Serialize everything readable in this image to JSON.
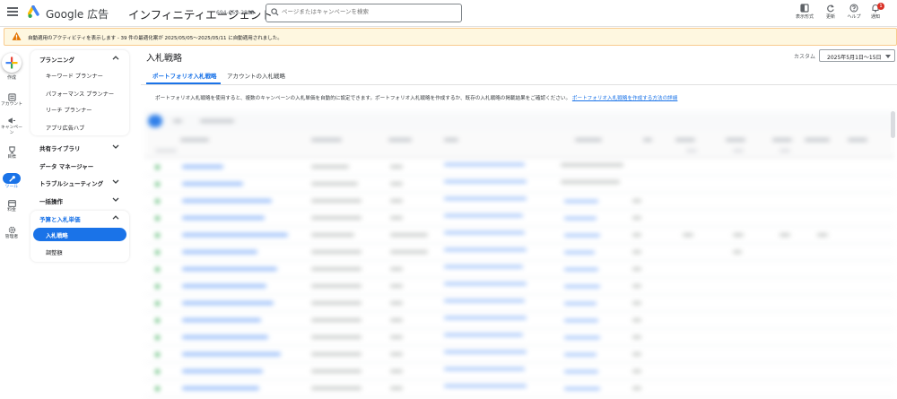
{
  "header": {
    "product": "Google 広告",
    "account_name": "インフィニティエージェント",
    "account_id": "694-655-2883",
    "search_placeholder": "ページまたはキャンペーンを検索",
    "tools": [
      {
        "icon": "appearance-icon",
        "label": "表示形式"
      },
      {
        "icon": "refresh-icon",
        "label": "更新"
      },
      {
        "icon": "help-icon",
        "label": "ヘルプ"
      },
      {
        "icon": "notifications-icon",
        "label": "通知",
        "badge": "1"
      }
    ]
  },
  "alert": {
    "text": "自動適用のアクティビティを表示します - 39 件の最適化案が 2025/05/05〜2025/05/11 に自動適用されました。"
  },
  "rail": {
    "create": "作成",
    "items": [
      {
        "icon": "account-icon",
        "label": "アカウント"
      },
      {
        "icon": "campaign-icon",
        "label": "キャンペーン"
      },
      {
        "icon": "goals-icon",
        "label": "目標"
      },
      {
        "icon": "tools-icon",
        "label": "ツール",
        "active": true
      },
      {
        "icon": "billing-icon",
        "label": "料金"
      },
      {
        "icon": "admin-icon",
        "label": "管理者"
      }
    ]
  },
  "nav": {
    "planning": {
      "label": "プランニング",
      "items": [
        "キーワード プランナー",
        "パフォーマンス プランナー",
        "リーチ プランナー",
        "アプリ広告ハブ"
      ]
    },
    "shared_library": "共有ライブラリ",
    "data_manager": "データ マネージャー",
    "troubleshooting": "トラブルシューティング",
    "bulk_actions": "一括操作",
    "budgets": {
      "label": "予算と入札単価",
      "items": [
        "入札戦略",
        "調整額"
      ],
      "active_item": "入札戦略"
    }
  },
  "main": {
    "title": "入札戦略",
    "date_label": "カスタム",
    "date_value": "2025年5月1日～15日",
    "tabs": [
      "ポートフォリオ入札戦略",
      "アカウントの入札戦略"
    ],
    "active_tab": "ポートフォリオ入札戦略",
    "description": "ポートフォリオ入札戦略を使用すると、複数のキャンペーンの入札単価を自動的に設定できます。ポートフォリオ入札戦略を作成するか、既存の入札戦略の掲載結果をご確認ください。",
    "description_link": "ポートフォリオ入札戦略を作成する方法の詳細"
  },
  "colors": {
    "accent": "#1a73e8",
    "alert_bg": "#fef7e0",
    "alert_icon": "#e37400",
    "status_enabled": "#34a853"
  }
}
